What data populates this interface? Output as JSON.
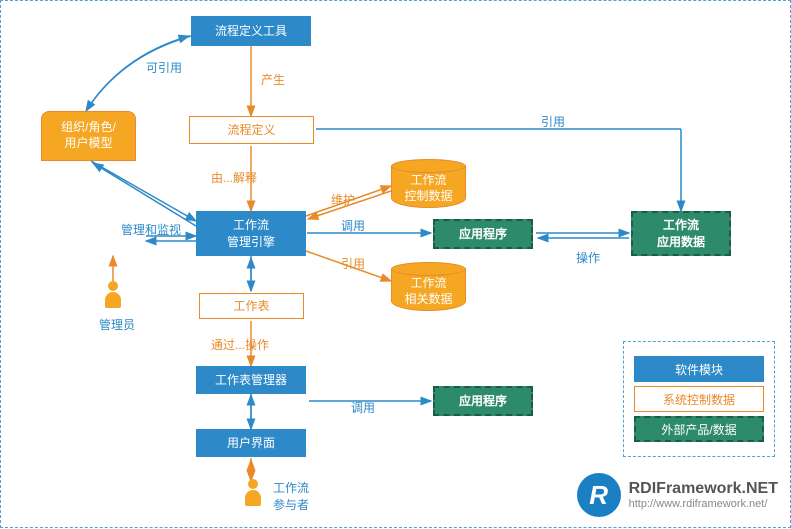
{
  "nodes": {
    "defTool": "流程定义工具",
    "procDef": "流程定义",
    "orgModel": "组织/角色/\n用户模型",
    "engine": "工作流\n管理引擎",
    "worksheet": "工作表",
    "wsMgr": "工作表管理器",
    "ui": "用户界面",
    "ctrlData": "工作流\n控制数据",
    "relData": "工作流\n相关数据",
    "app1": "应用程序",
    "app2": "应用程序",
    "appData": "工作流\n应用数据"
  },
  "labels": {
    "canRef": "可引用",
    "produce": "产生",
    "interpret": "由...解释",
    "monitor": "管理和监视",
    "operateVia": "通过...操作",
    "maintain": "维护",
    "call": "调用",
    "ref": "引用",
    "quote": "引用",
    "operate": "操作",
    "call2": "调用"
  },
  "actors": {
    "admin": "管理员",
    "participant": "工作流\n参与者"
  },
  "legend": {
    "soft": "软件模块",
    "sysCtrl": "系统控制数据",
    "extProd": "外部产品/数据"
  },
  "watermark": {
    "logo": "R",
    "brand": "RDIFramework.NET",
    "url": "http://www.rdiframework.net/"
  }
}
